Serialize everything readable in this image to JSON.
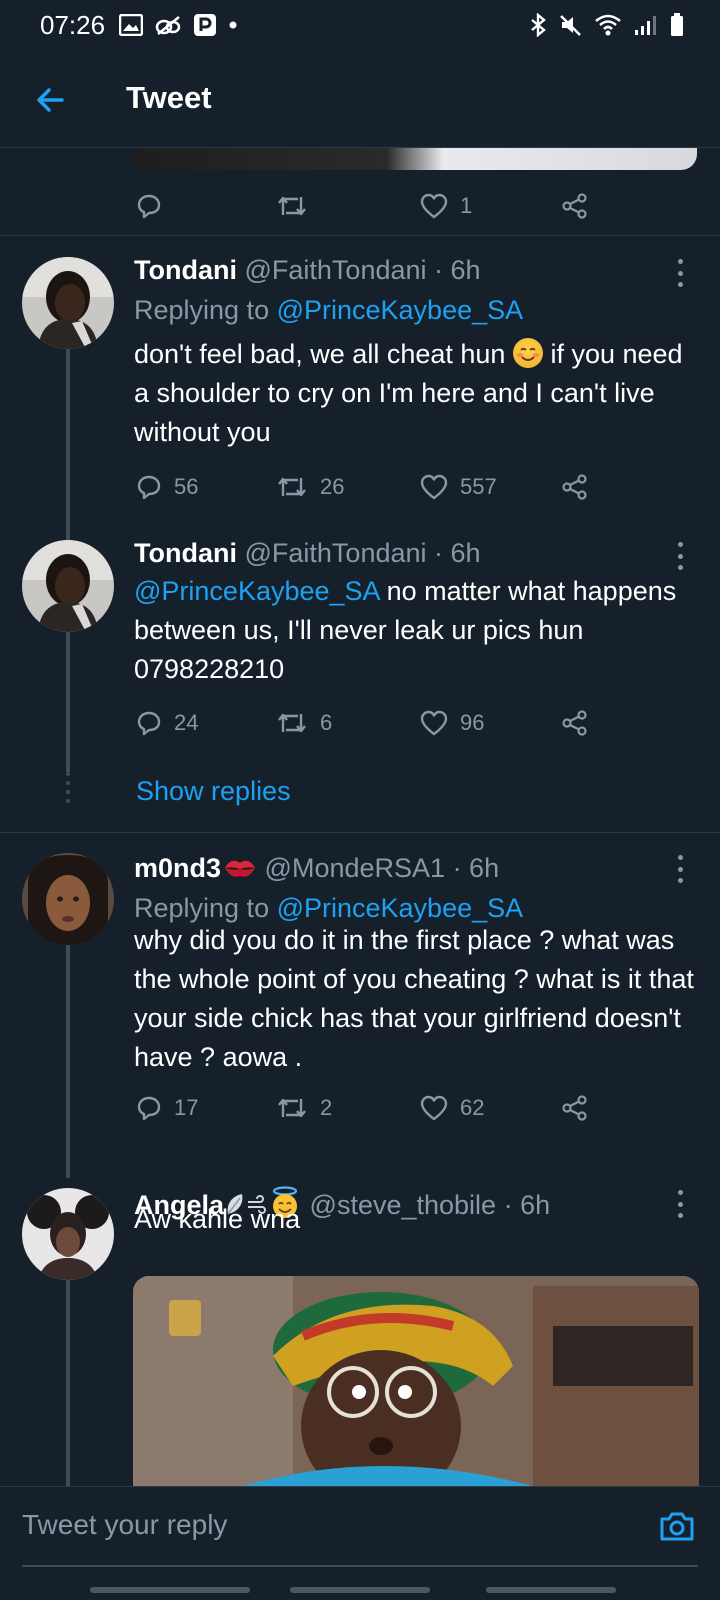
{
  "status_bar": {
    "time": "07:26"
  },
  "header": {
    "title": "Tweet"
  },
  "top_tweet": {
    "like_count": "1"
  },
  "tweets": [
    {
      "name": "Tondani",
      "handle": "@FaithTondani",
      "time": "· 6h",
      "replying_prefix": "Replying to ",
      "replying_to": "@PrinceKaybee_SA",
      "text_1": "don't feel bad, we all cheat hun ",
      "text_2": " if you need a shoulder to cry on I'm here and I can't live without you",
      "replies": "56",
      "retweets": "26",
      "likes": "557"
    },
    {
      "name": "Tondani",
      "handle": "@FaithTondani",
      "time": "· 6h",
      "mention": "@PrinceKaybee_SA",
      "text": " no matter what happens between us, I'll never leak ur pics hun 0798228210",
      "replies": "24",
      "retweets": "6",
      "likes": "96",
      "show_replies": "Show replies"
    },
    {
      "name": "m0nd3",
      "handle": "@MondeRSA1",
      "time": "· 6h",
      "replying_prefix": "Replying to ",
      "replying_to": "@PrinceKaybee_SA",
      "text": "why did you do it in the first place ? what was the whole point of you cheating ? what is it that your side chick has that your girlfriend doesn't have ? aowa .",
      "replies": "17",
      "retweets": "2",
      "likes": "62"
    },
    {
      "name": "Angela",
      "handle": "@steve_thobile",
      "time": "· 6h",
      "text": "Aw kahle wna"
    }
  ],
  "reply_bar": {
    "placeholder": "Tweet your reply"
  },
  "colors": {
    "background": "#15202b",
    "accent": "#1da1f2",
    "muted": "#8899a6",
    "divider": "#2f3b47"
  }
}
